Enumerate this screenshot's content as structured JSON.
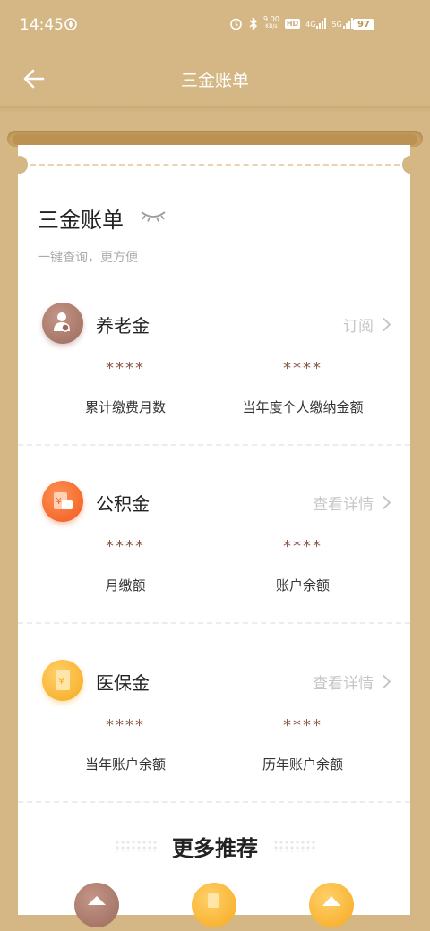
{
  "status_bar": {
    "time": "14:45",
    "net_speed_top": "9.00",
    "net_speed_unit": "KB/s",
    "hd_label": "HD",
    "net_4g": "4G",
    "net_5g": "5G",
    "battery": "97"
  },
  "header": {
    "title": "三金账单"
  },
  "card": {
    "title": "三金账单",
    "subtitle": "一键查询，更方便"
  },
  "sections": [
    {
      "name": "养老金",
      "link": "订阅",
      "value_left": "****",
      "label_left": "累计缴费月数",
      "value_right": "****",
      "label_right": "当年度个人缴纳金额",
      "icon": "pension-person-icon",
      "color": "#a8776a"
    },
    {
      "name": "公积金",
      "link": "查看详情",
      "value_left": "****",
      "label_left": "月缴额",
      "value_right": "****",
      "label_right": "账户余额",
      "icon": "housing-fund-card-icon",
      "color": "#f36a2a"
    },
    {
      "name": "医保金",
      "link": "查看详情",
      "value_left": "****",
      "label_left": "当年账户余额",
      "value_right": "****",
      "label_right": "历年账户余额",
      "icon": "medical-insurance-doc-icon",
      "color": "#f8b22c"
    }
  ],
  "more": {
    "title": "更多推荐"
  },
  "colors": {
    "background": "#d4b784",
    "card": "#ffffff",
    "value_text": "#8a5a4a",
    "link_text": "#c6c6c6"
  }
}
